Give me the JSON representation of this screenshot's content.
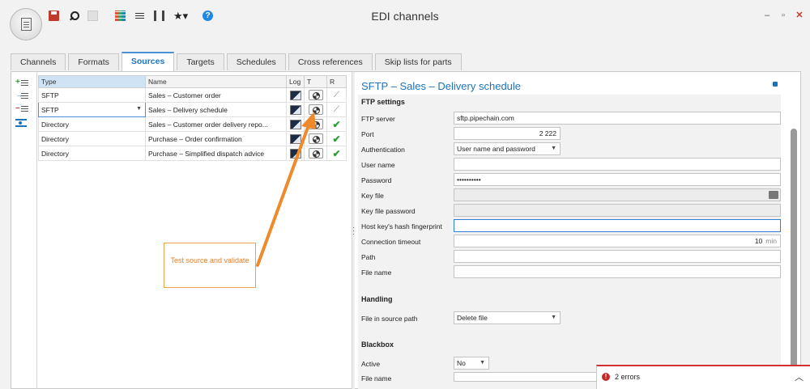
{
  "window": {
    "title": "EDI channels"
  },
  "tabs": [
    {
      "label": "Channels"
    },
    {
      "label": "Formats"
    },
    {
      "label": "Sources"
    },
    {
      "label": "Targets"
    },
    {
      "label": "Schedules"
    },
    {
      "label": "Cross references"
    },
    {
      "label": "Skip lists for parts"
    }
  ],
  "active_tab": "Sources",
  "grid": {
    "columns": [
      "Type",
      "Name",
      "Log",
      "T",
      "R"
    ],
    "rows": [
      {
        "type": "SFTP",
        "name": "Sales – Customer order",
        "result": "wand"
      },
      {
        "type": "SFTP",
        "name": "Sales – Delivery schedule",
        "result": "wand",
        "selected": true
      },
      {
        "type": "Directory",
        "name": "Sales – Customer order delivery repo...",
        "result": "check"
      },
      {
        "type": "Directory",
        "name": "Purchase – Order confirmation",
        "result": "check"
      },
      {
        "type": "Directory",
        "name": "Purchase – Simplified dispatch advice",
        "result": "check"
      }
    ]
  },
  "detail": {
    "title": "SFTP – Sales – Delivery schedule",
    "ftp_section": "FTP settings",
    "ftp_server_label": "FTP server",
    "ftp_server_value": "sftp.pipechain.com",
    "port_label": "Port",
    "port_value": "2 222",
    "auth_label": "Authentication",
    "auth_value": "User name and password",
    "user_label": "User name",
    "password_label": "Password",
    "password_value": "••••••••••",
    "keyfile_label": "Key file",
    "keyfile_pw_label": "Key file password",
    "hostkey_label": "Host key's hash fingerprint",
    "timeout_label": "Connection timeout",
    "timeout_value": "10",
    "timeout_unit": "min",
    "path_label": "Path",
    "filename_label": "File name",
    "handling_section": "Handling",
    "file_in_path_label": "File in source path",
    "file_in_path_value": "Delete file",
    "blackbox_section": "Blackbox",
    "active_label": "Active",
    "active_value": "No",
    "filename2_label": "File name"
  },
  "annotation": {
    "text": "Test source and validate"
  },
  "errors": {
    "text": "2 errors"
  },
  "colors": {
    "accent": "#1e73be",
    "callout": "#e67e22",
    "error": "#c62828"
  }
}
